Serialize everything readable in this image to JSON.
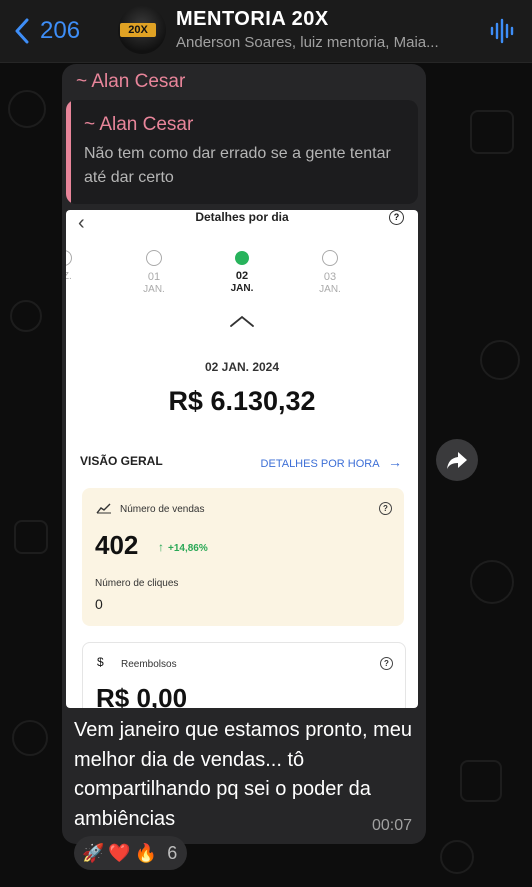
{
  "header": {
    "back_count": "206",
    "avatar_badge": "20X",
    "title": "MENTORIA 20X",
    "members": "Anderson Soares, luiz mentoria, Maia..."
  },
  "message": {
    "sender": "~ Alan Cesar",
    "reply": {
      "sender": "~ Alan Cesar",
      "text": "Não tem como dar errado se a gente tentar até dar certo"
    },
    "screenshot": {
      "title": "Detalhes por dia",
      "help": "?",
      "days": [
        {
          "num": "",
          "mon": "EZ."
        },
        {
          "num": "01",
          "mon": "JAN."
        },
        {
          "num": "02",
          "mon": "JAN."
        },
        {
          "num": "03",
          "mon": "JAN."
        }
      ],
      "date": "02 JAN. 2024",
      "amount": "R$ 6.130,32",
      "overview_label": "VISÃO GERAL",
      "hourly_link": "DETALHES POR HORA",
      "sales_label": "Número de vendas",
      "sales_value": "402",
      "sales_delta": "+14,86%",
      "clicks_label": "Número de cliques",
      "clicks_value": "0",
      "refunds_label": "Reembolsos",
      "refunds_value": "R$ 0,00"
    },
    "text": "Vem janeiro que estamos pronto, meu melhor dia de vendas... tô compartilhando pq sei o poder da ambiências",
    "time": "00:07"
  },
  "reactions": {
    "emojis": [
      "🚀",
      "❤️",
      "🔥"
    ],
    "count": "6"
  },
  "colors": {
    "accent": "#3e8ef7",
    "sender": "#e8859a",
    "bubble": "#262628",
    "success": "#28b35c"
  }
}
